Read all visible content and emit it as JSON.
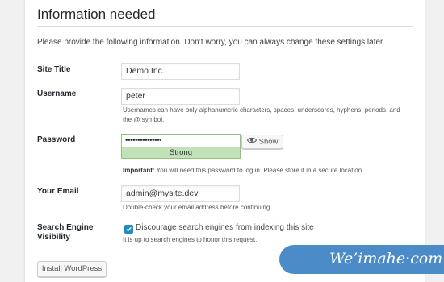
{
  "heading": "Information needed",
  "intro": "Please provide the following information. Don’t worry, you can always change these settings later.",
  "site_title": {
    "label": "Site Title",
    "value": "Demo Inc."
  },
  "username": {
    "label": "Username",
    "value": "peter",
    "help_line1": "Usernames can have only alphanumeric characters, spaces, underscores, hyphens, periods, and",
    "help_line2": "the @ symbol."
  },
  "password": {
    "label": "Password",
    "value": "•••••••••••••••",
    "strength": "Strong",
    "show_label": "Show",
    "note_strong": "Important:",
    "note_rest": " You will need this password to log in. Please store it in a secure location."
  },
  "email": {
    "label": "Your Email",
    "value": "admin@mysite.dev",
    "help": "Double-check your email address before continuing."
  },
  "search_visibility": {
    "label_line1": "Search Engine",
    "label_line2": "Visibility",
    "checkbox_label": "Discourage search engines from indexing this site",
    "checked": true,
    "help": "It is up to search engines to honor this request."
  },
  "install_button": "Install WordPress",
  "watermark": "We’imahe·com",
  "colors": {
    "accent_blue": "#1e8cbe",
    "strength_bg": "#c1e1b9",
    "strength_border": "#8fc37f",
    "watermark_bg": "#4a8bc8"
  }
}
